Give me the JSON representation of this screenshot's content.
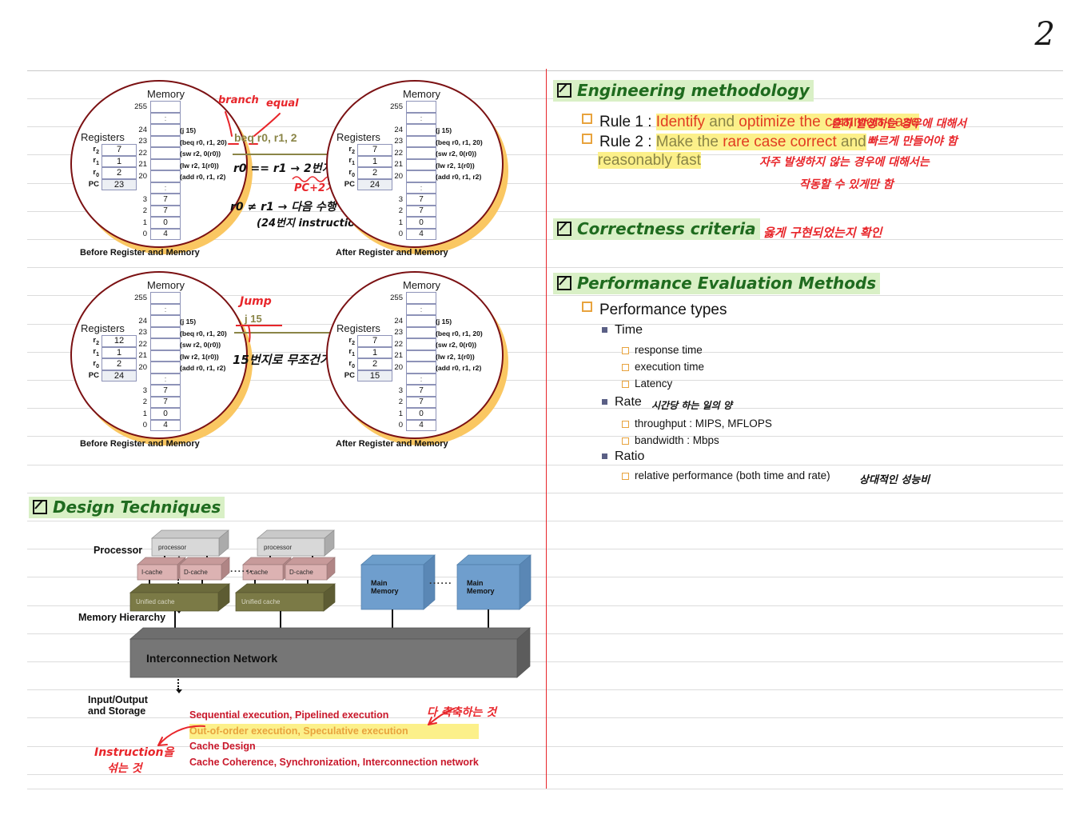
{
  "page": {
    "number": "2"
  },
  "slide1": {
    "before_caption": "Before Register and Memory",
    "after_caption": "After Register and Memory",
    "memory_title": "Memory",
    "registers_title": "Registers",
    "before_registers": [
      {
        "label": "r2",
        "value": "7"
      },
      {
        "label": "r1",
        "value": "1"
      },
      {
        "label": "r0",
        "value": "2"
      },
      {
        "label": "PC",
        "value": "23"
      }
    ],
    "after_registers": [
      {
        "label": "r2",
        "value": "7"
      },
      {
        "label": "r1",
        "value": "1"
      },
      {
        "label": "r0",
        "value": "2"
      },
      {
        "label": "PC",
        "value": "24"
      }
    ],
    "memory_rows": [
      {
        "index": "255",
        "value": ""
      },
      {
        "index": "",
        "value": ":"
      },
      {
        "index": "24",
        "value": ""
      },
      {
        "index": "23",
        "value": ""
      },
      {
        "index": "22",
        "value": ""
      },
      {
        "index": "21",
        "value": ""
      },
      {
        "index": "20",
        "value": ""
      },
      {
        "index": "",
        "value": ":"
      },
      {
        "index": "3",
        "value": "7"
      },
      {
        "index": "2",
        "value": "7"
      },
      {
        "index": "1",
        "value": "0"
      },
      {
        "index": "0",
        "value": "4"
      }
    ],
    "memory_notes": [
      "(j 15)",
      "(beq r0, r1, 20)",
      "(sw r2, 0(r0))",
      "(lw r2, 1(r0))",
      "(add r0, r1, r2)"
    ],
    "instruction": "beq r0, r1, 2",
    "ann_branch": "branch",
    "ann_equal": "equal",
    "ann_line1": "r0 == r1  → 2번지",
    "ann_line2": "PC+2가됨",
    "ann_line3": "r0 ≠ r1   → 다음 수행",
    "ann_line4": "(24번지 instruction)"
  },
  "slide2": {
    "before_caption": "Before Register and Memory",
    "after_caption": "After Register and Memory",
    "memory_title": "Memory",
    "registers_title": "Registers",
    "before_registers": [
      {
        "label": "r2",
        "value": "12"
      },
      {
        "label": "r1",
        "value": "1"
      },
      {
        "label": "r0",
        "value": "2"
      },
      {
        "label": "PC",
        "value": "24"
      }
    ],
    "after_registers": [
      {
        "label": "r2",
        "value": "7"
      },
      {
        "label": "r1",
        "value": "1"
      },
      {
        "label": "r0",
        "value": "2"
      },
      {
        "label": "PC",
        "value": "15"
      }
    ],
    "memory_rows": [
      {
        "index": "255",
        "value": ""
      },
      {
        "index": "",
        "value": ":"
      },
      {
        "index": "24",
        "value": ""
      },
      {
        "index": "23",
        "value": ""
      },
      {
        "index": "22",
        "value": ""
      },
      {
        "index": "21",
        "value": ""
      },
      {
        "index": "20",
        "value": ""
      },
      {
        "index": "",
        "value": ":"
      },
      {
        "index": "3",
        "value": "7"
      },
      {
        "index": "2",
        "value": "7"
      },
      {
        "index": "1",
        "value": "0"
      },
      {
        "index": "0",
        "value": "4"
      }
    ],
    "memory_notes": [
      "(j 15)",
      "(beq r0, r1, 20)",
      "(sw r2, 0(r0))",
      "(lw r2, 1(r0))",
      "(add r0, r1, r2)"
    ],
    "instruction": "j 15",
    "ann_jump": "Jump",
    "ann_korean": "15번지로 무조건가라"
  },
  "right": {
    "h1": "Engineering methodology",
    "rule1_prefix": "Rule 1 : ",
    "rule1_a": "Identify",
    "rule1_b": " and ",
    "rule1_c": "optimize the common case",
    "rule2_prefix": "Rule 2 : ",
    "rule2_a": "Make the ",
    "rule2_b": "rare case correct",
    "rule2_c": " and",
    "rule2_d": "reasonably fast",
    "note1_l1": "흔히 발생하는 경우에 대해서",
    "note1_l2": "빠르게 만들어야 함",
    "note2_l1": "자주 발생하지 않는 경우에 대해서는",
    "note2_l2": "작동할 수 있게만 함",
    "h2": "Correctness criteria",
    "note3": "옳게 구현되었는지 확인",
    "h3": "Performance Evaluation Methods",
    "perf_types": "Performance types",
    "time": "Time",
    "time_items": [
      "response time",
      "execution time",
      "Latency"
    ],
    "rate": "Rate",
    "rate_note": "시간당 하는 일의 양",
    "rate_items": [
      "throughput : MIPS, MFLOPS",
      "bandwidth : Mbps"
    ],
    "ratio": "Ratio",
    "ratio_items": [
      "relative performance (both time and rate)"
    ],
    "ratio_note": "상대적인 성능비"
  },
  "design": {
    "header": "Design Techniques",
    "label_processor": "Processor",
    "label_memhier": "Memory Hierarchy",
    "label_io_l1": "Input/Output",
    "label_io_l2": "and Storage",
    "box_processor": "processor",
    "box_icache": "I-cache",
    "box_dcache": "D-cache",
    "box_unified": "Unified cache",
    "box_mainmem_l1": "Main",
    "box_mainmem_l2": "Memory",
    "box_network": "Interconnection Network",
    "ellipsis": "......",
    "red_line1": "Sequential execution, Pipelined execution",
    "red_line2": "Out-of-order execution, Speculative execution",
    "red_line3": "Cache Design",
    "red_line4": "Cache Coherence, Synchronization, Interconnection network",
    "note_right": "다 축축하는 것",
    "note_left_l1": "Instruction을",
    "note_left_l2": "섞는 것"
  },
  "colors": {
    "highlight_yellow": "#fcf08a",
    "highlight_green": "#d9f0c6",
    "red_ink": "#e8262b",
    "green_ink": "#1f6b1f",
    "olive": "#8a8547",
    "orange_bullet": "#e8a33d",
    "navy_bullet": "#5a5f85",
    "circle_stroke": "#7b1113",
    "circle_shadow": "#fac45a"
  }
}
